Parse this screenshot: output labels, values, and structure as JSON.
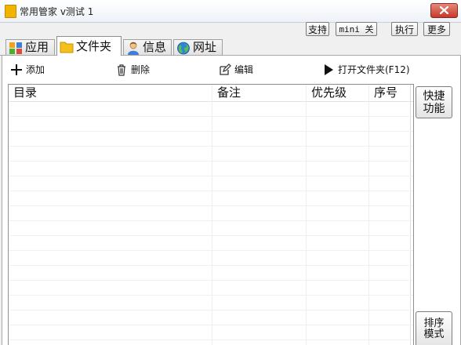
{
  "window": {
    "title": "常用管家 v测试 1"
  },
  "top_buttons": {
    "support": "支持",
    "mini": "mini 关",
    "execute": "执行",
    "more": "更多"
  },
  "tabs": [
    {
      "label": "应用",
      "icon": "apps-icon",
      "active": false
    },
    {
      "label": "文件夹",
      "icon": "folder-icon",
      "active": true
    },
    {
      "label": "信息",
      "icon": "user-icon",
      "active": false
    },
    {
      "label": "网址",
      "icon": "globe-icon",
      "active": false
    }
  ],
  "toolbar": {
    "add_label": "添加",
    "delete_label": "删除",
    "edit_label": "编辑",
    "open_label": "打开文件夹(F12)"
  },
  "table": {
    "columns": [
      "目录",
      "备注",
      "优先级",
      "序号"
    ],
    "rows": []
  },
  "side_buttons": {
    "quick": [
      "快捷",
      "功能"
    ],
    "sort": [
      "排序",
      "模式"
    ]
  },
  "colors": {
    "close_red": "#c8382a",
    "folder_yellow": "#f0b400"
  }
}
